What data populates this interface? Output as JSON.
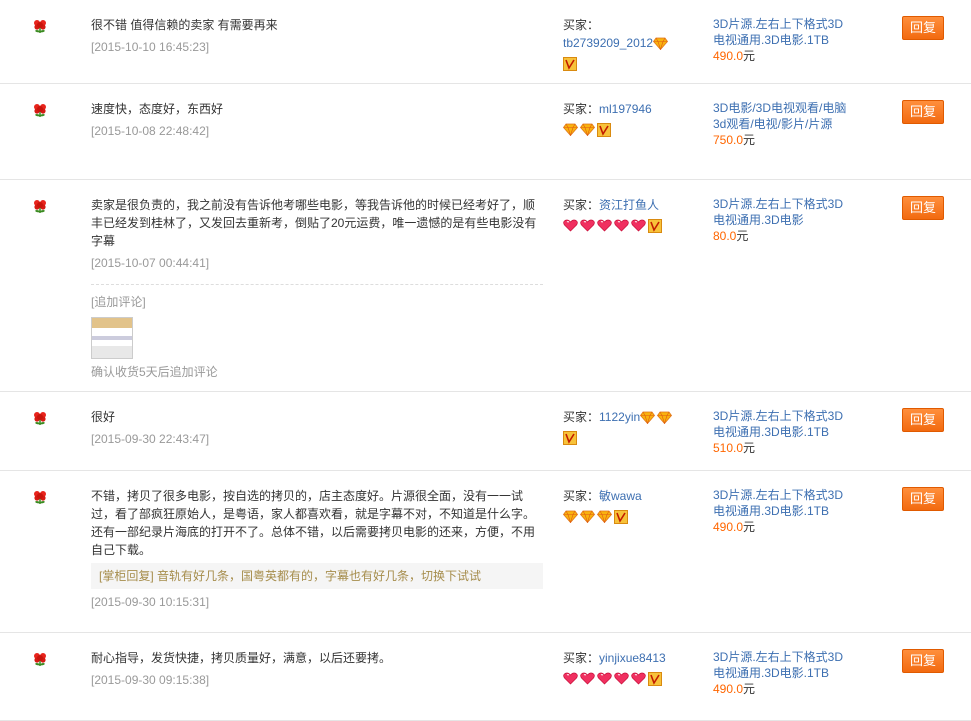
{
  "buyer_label": "买家：",
  "reply_label": "回复",
  "currency_unit": "元",
  "reviews": [
    {
      "text": "很不错 值得信赖的卖家 有需要再来",
      "date": "[2015-10-10 16:45:23]",
      "buyer": "tb2739209_2012",
      "credit": {
        "type": "diamond",
        "count": 1
      },
      "item": "3D片源.左右上下格式3D电视通用.3D电影.1TB",
      "price": "490.0"
    },
    {
      "text": "速度快，态度好，东西好",
      "date": "[2015-10-08 22:48:42]",
      "buyer": "ml197946",
      "credit": {
        "type": "diamond",
        "count": 2
      },
      "item": "3D电影/3D电视观看/电脑3d观看/电视/影片/片源",
      "price": "750.0"
    },
    {
      "text": "卖家是很负责的，我之前没有告诉他考哪些电影，等我告诉他的时候已经考好了，顺丰已经发到桂林了，又发回去重新考，倒贴了20元运费，唯一遗憾的是有些电影没有字幕",
      "date": "[2015-10-07 00:44:41]",
      "buyer": "资江打鱼人",
      "credit": {
        "type": "heart",
        "count": 5
      },
      "item": "3D片源.左右上下格式3D电视通用.3D电影",
      "price": "80.0",
      "append_label": "[追加评论]",
      "append_note": "确认收货5天后追加评论"
    },
    {
      "text": "很好",
      "date": "[2015-09-30 22:43:47]",
      "buyer": "1122yin",
      "credit": {
        "type": "diamond",
        "count": 2
      },
      "item": "3D片源.左右上下格式3D电视通用.3D电影.1TB",
      "price": "510.0"
    },
    {
      "text": "不错，拷贝了很多电影，按自选的拷贝的，店主态度好。片源很全面，没有一一试过，看了部疯狂原始人，是粤语，家人都喜欢看，就是字幕不对，不知道是什么字。还有一部纪录片海底的打开不了。总体不错，以后需要拷贝电影的还来，方便，不用自己下载。",
      "seller_reply": "[掌柜回复] 音轨有好几条，国粤英都有的，字幕也有好几条，切换下试试",
      "date": "[2015-09-30 10:15:31]",
      "buyer": "敏wawa",
      "credit": {
        "type": "diamond",
        "count": 3
      },
      "item": "3D片源.左右上下格式3D电视通用.3D电影.1TB",
      "price": "490.0"
    },
    {
      "text": "耐心指导，发货快捷，拷贝质量好，满意，以后还要拷。",
      "date": "[2015-09-30 09:15:38]",
      "buyer": "yinjixue8413",
      "credit": {
        "type": "heart",
        "count": 5
      },
      "item": "3D片源.左右上下格式3D电视通用.3D电影.1TB",
      "price": "490.0"
    }
  ]
}
